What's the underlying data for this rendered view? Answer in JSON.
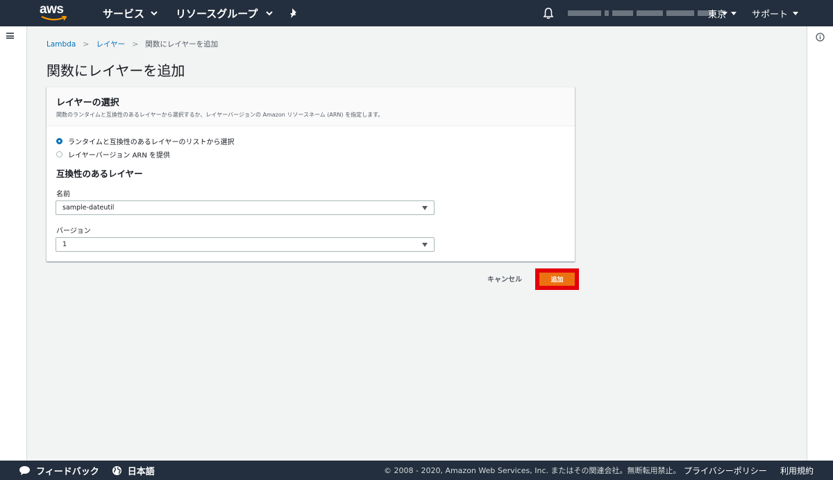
{
  "topnav": {
    "logo": "aws",
    "services_label": "サービス",
    "resource_groups_label": "リソースグループ",
    "region_label": "東京",
    "support_label": "サポート"
  },
  "breadcrumb": {
    "items": [
      "Lambda",
      "レイヤー"
    ],
    "current": "関数にレイヤーを追加"
  },
  "page": {
    "title": "関数にレイヤーを追加"
  },
  "card": {
    "title": "レイヤーの選択",
    "description": "関数のランタイムと互換性のあるレイヤーから選択するか、レイヤーバージョンの Amazon リソースネーム (ARN) を指定します。",
    "radio_options": [
      {
        "label": "ランタイムと互換性のあるレイヤーのリストから選択",
        "selected": true
      },
      {
        "label": "レイヤーバージョン ARN を提供",
        "selected": false
      }
    ],
    "section_title": "互換性のあるレイヤー",
    "name_label": "名前",
    "name_value": "sample-dateutil",
    "version_label": "バージョン",
    "version_value": "1"
  },
  "actions": {
    "cancel_label": "キャンセル",
    "add_label": "追加"
  },
  "footer": {
    "feedback_label": "フィードバック",
    "language_label": "日本語",
    "copyright": "© 2008 - 2020, Amazon Web Services, Inc. またはその関連会社。無断転用禁止。",
    "privacy_label": "プライバシーポリシー",
    "terms_label": "利用規約"
  },
  "colors": {
    "nav_bg": "#232f3e",
    "link": "#0073bb",
    "primary_button": "#ec7211",
    "highlight": "#e3000b"
  }
}
